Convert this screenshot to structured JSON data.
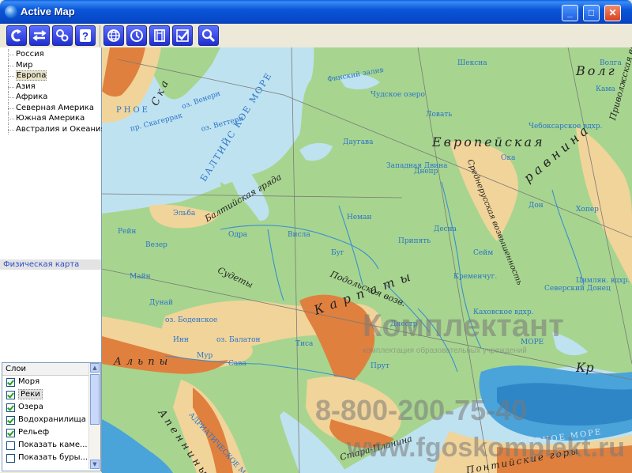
{
  "window": {
    "title": "Active Map",
    "controls": {
      "minimize": "_",
      "maximize": "□",
      "close": "✕"
    }
  },
  "toolbar": {
    "left_tools": [
      "back-icon",
      "layers-toggle-icon",
      "settings-icon",
      "help-icon"
    ],
    "right_tools": [
      "globe-icon",
      "clock-icon",
      "book-icon",
      "check-icon",
      "zoom-icon"
    ]
  },
  "regions": [
    "Россия",
    "Мир",
    "Европа",
    "Азия",
    "Африка",
    "Северная Америка",
    "Южная Америка",
    "Австралия и Океания"
  ],
  "selected_region": "Европа",
  "map_type": "Физическая карта",
  "layers": {
    "title": "Слои",
    "items": [
      {
        "label": "Моря",
        "checked": true
      },
      {
        "label": "Реки",
        "checked": true
      },
      {
        "label": "Озера",
        "checked": true
      },
      {
        "label": "Водохранилища",
        "checked": true
      },
      {
        "label": "Рельеф",
        "checked": true
      },
      {
        "label": "Показать каме...",
        "checked": false
      },
      {
        "label": "Показать буры...",
        "checked": false
      }
    ]
  },
  "map_labels": {
    "sea_baltic": "БАЛТИЙС КОЕ МОРЕ",
    "sea_north": "РНОЕ",
    "sea_black": "ЧЁРНОЕ МОРЕ",
    "sea_adriatic": "АДРИАТИЧЕСКОЕ МОРЕ",
    "sea_azov": "МОРЕ",
    "plain_east_european": "Европейская",
    "plain_east_european_2": "равнина",
    "volga_upland": "Приволжская возв.",
    "central_russian": "Среднерусская возвышенность",
    "baltic_ridge": "Балтийская гряда",
    "carpathians": "Карпаты",
    "sudetes": "Судеты",
    "podolsk": "Подольская возв.",
    "alps": "Альпы",
    "apennines": "Апеннины",
    "stara_planina": "Стара-Планина",
    "pontic": "Понтийские горы",
    "crimean": "Кр",
    "skagerrak": "пр. Скагеррак",
    "vener": "оз. Венерн",
    "vetter": "оз. Веттерн",
    "finland_gulf": "Финский залив",
    "chudskoe": "Чудское озеро",
    "balaton": "оз. Балатон",
    "bodensee": "оз. Боденское",
    "rivers": [
      "Даугава",
      "Неман",
      "Висла",
      "Одра",
      "Эльба",
      "Рейн",
      "Дунай",
      "Тиса",
      "Днепр",
      "Десна",
      "Припять",
      "Буг",
      "Днестр",
      "Дон",
      "Хопер",
      "Ока",
      "Северский Донец",
      "Сава",
      "Инн",
      "Мур",
      "Прут",
      "Сейм",
      "Западная Двина",
      "Кама",
      "Волга",
      "Чебоксарское вдхр.",
      "Кахов­ское вдхр.",
      "Цимлян. вдхр.",
      "Кременчуг.",
      "Везер",
      "Майн",
      "Ловать",
      "Шексна"
    ],
    "volga_hills": "Волг",
    "ska": "Ска"
  },
  "watermark": {
    "brand": "Комплектант",
    "tagline": "комплектация образовательных учреждений",
    "phone": "8-800-200-75-40",
    "site": "www.fgoskomplekt.ru"
  },
  "colors": {
    "titlebar": "#0a56d8",
    "sea": "#bfe2f0",
    "lowland": "#a7d58f",
    "upland": "#f1d49a",
    "mountain": "#e0803e",
    "deep_sea": "#4aa3d9",
    "map_type_text": "#2d4fc8"
  }
}
